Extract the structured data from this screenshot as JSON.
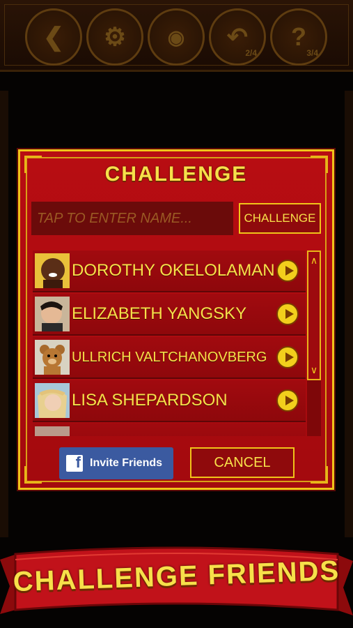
{
  "toolbar": {
    "buttons": [
      {
        "icon": "back-arrow-icon"
      },
      {
        "icon": "gear-icon"
      },
      {
        "icon": "video-camera-icon"
      },
      {
        "icon": "undo-arrow-icon",
        "count": "2/4"
      },
      {
        "icon": "question-mark-icon",
        "count": "3/4"
      }
    ]
  },
  "dialog": {
    "title": "CHALLENGE",
    "name_placeholder": "TAP TO ENTER NAME...",
    "challenge_button": "CHALLENGE",
    "friends": [
      {
        "name": "DOROTHY OKELOLAMAN",
        "avatar": "woman-avatar"
      },
      {
        "name": "ELIZABETH YANGSKY",
        "avatar": "person-avatar"
      },
      {
        "name": "ULLRICH VALTCHANOVBERG",
        "avatar": "teddy-bear-avatar"
      },
      {
        "name": "LISA SHEPARDSON",
        "avatar": "blonde-avatar"
      }
    ],
    "invite_button": "Invite Friends",
    "cancel_button": "CANCEL"
  },
  "banner": {
    "text": "CHALLENGE FRIENDS"
  },
  "colors": {
    "accent": "#f7e04a",
    "panel": "#a30a0e",
    "border": "#f0c419",
    "facebook": "#3b5aa0"
  }
}
